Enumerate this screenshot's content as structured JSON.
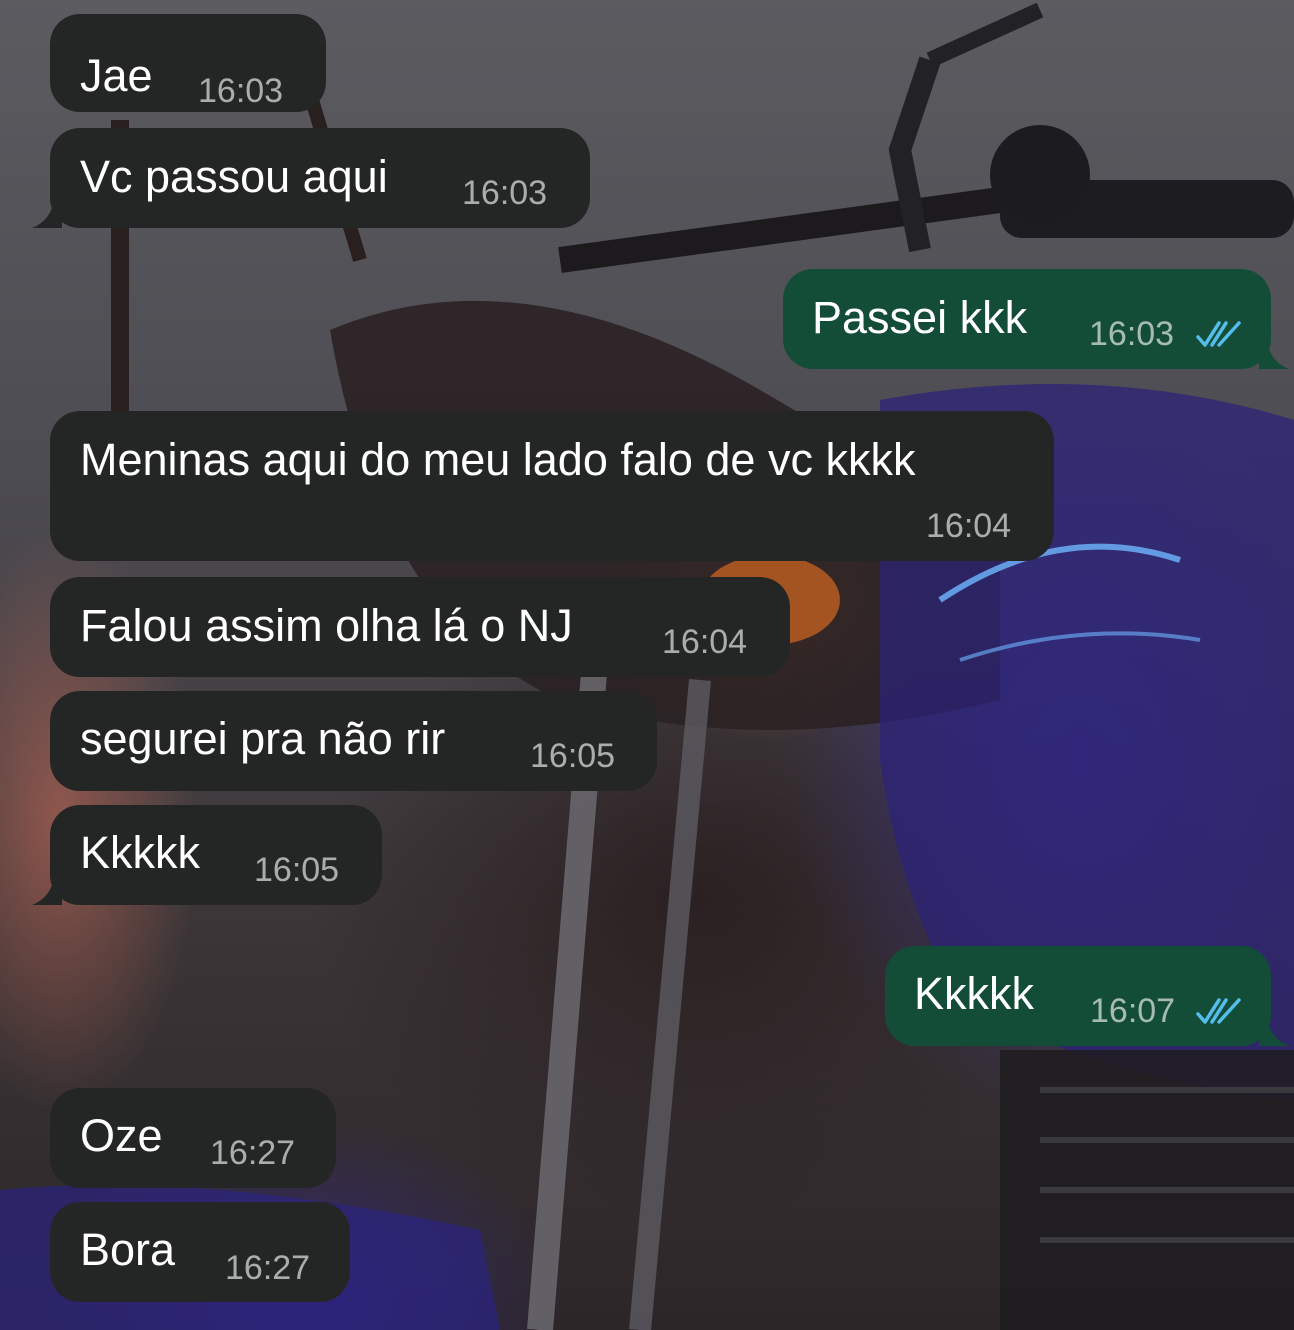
{
  "messages": [
    {
      "id": "m1",
      "direction": "incoming",
      "text": "Jae",
      "time": "16:03"
    },
    {
      "id": "m2",
      "direction": "incoming",
      "text": "Vc passou aqui",
      "time": "16:03"
    },
    {
      "id": "m3",
      "direction": "outgoing",
      "text": "Passei kkk",
      "time": "16:03",
      "status": "read-double-check-icon"
    },
    {
      "id": "m4",
      "direction": "incoming",
      "text": "Meninas aqui do meu lado falo de vc kkkk",
      "time": "16:04"
    },
    {
      "id": "m5",
      "direction": "incoming",
      "text": "Falou assim olha lá o NJ",
      "time": "16:04"
    },
    {
      "id": "m6",
      "direction": "incoming",
      "text": "segurei pra não rir",
      "time": "16:05"
    },
    {
      "id": "m7",
      "direction": "incoming",
      "text": "Kkkkk",
      "time": "16:05"
    },
    {
      "id": "m8",
      "direction": "outgoing",
      "text": "Kkkkk",
      "time": "16:07",
      "status": "read-double-check-icon"
    },
    {
      "id": "m9",
      "direction": "incoming",
      "text": "Oze",
      "time": "16:27"
    },
    {
      "id": "m10",
      "direction": "incoming",
      "text": "Bora",
      "time": "16:27"
    }
  ],
  "colors": {
    "incoming_bubble": "#242626",
    "outgoing_bubble": "#144d37",
    "read_ticks": "#53bdeb",
    "text": "#ffffff"
  },
  "wallpaper": "motorcycle-photo"
}
